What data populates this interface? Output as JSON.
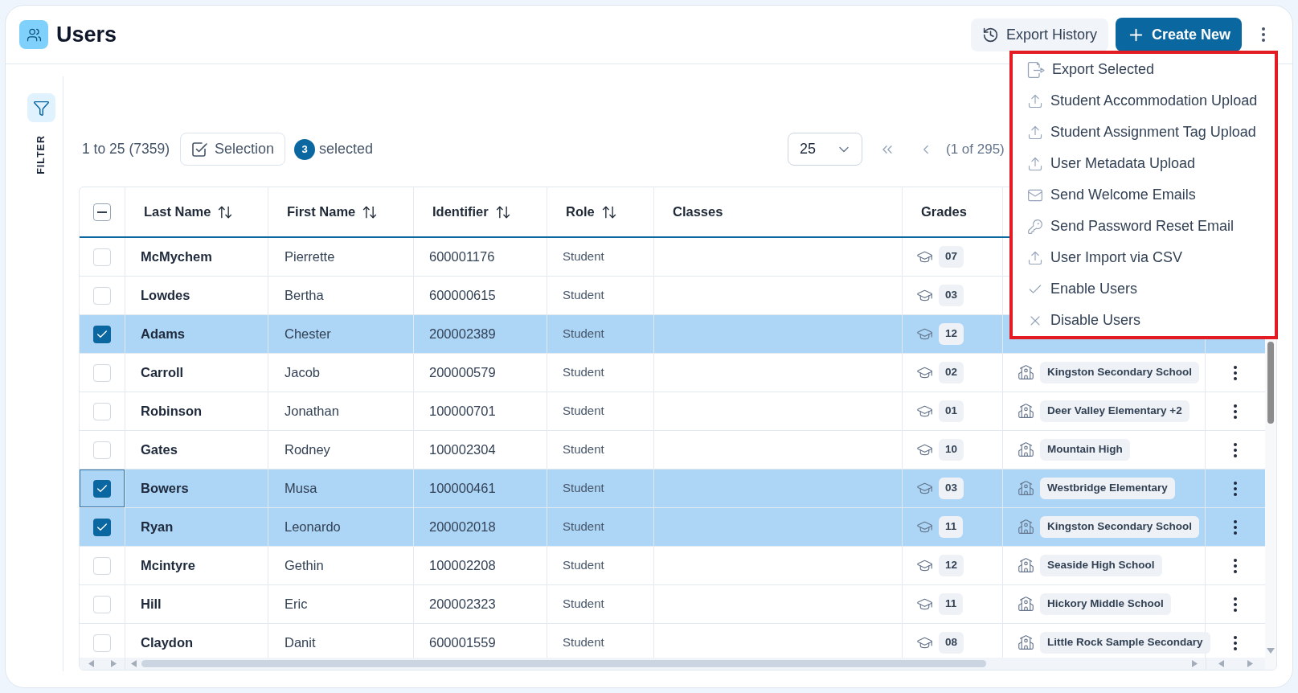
{
  "header": {
    "title": "Users",
    "buttons": [
      {
        "kind": "history",
        "label": "Export History"
      },
      {
        "kind": "create",
        "label": "Create New"
      }
    ]
  },
  "actions_menu": {
    "items": [
      {
        "kind": "export",
        "label": "Export Selected"
      },
      {
        "kind": "upload",
        "label": "Student Accommodation Upload"
      },
      {
        "kind": "upload",
        "label": "Student Assignment Tag Upload"
      },
      {
        "kind": "upload",
        "label": "User Metadata Upload"
      },
      {
        "kind": "email",
        "label": "Send Welcome Emails"
      },
      {
        "kind": "password",
        "label": "Send Password Reset Email"
      },
      {
        "kind": "upload",
        "label": "User Import via CSV"
      },
      {
        "kind": "enable",
        "label": "Enable Users"
      },
      {
        "kind": "disable",
        "label": "Disable Users"
      }
    ]
  },
  "sidebar": {
    "filter_label": "FILTER"
  },
  "toolbar": {
    "range": "1 to 25 (7359)",
    "selection_button": "Selection",
    "selected_count": "3",
    "selected_label": "selected",
    "page_size": "25",
    "page_info": "(1 of 295)"
  },
  "table": {
    "select_all": {
      "indeterminate": true
    },
    "columns": [
      {
        "label": "Last Name",
        "sortable": true
      },
      {
        "label": "First Name",
        "sortable": true
      },
      {
        "label": "Identifier",
        "sortable": true
      },
      {
        "label": "Role",
        "sortable": true
      },
      {
        "label": "Classes",
        "sortable": false
      },
      {
        "label": "Grades",
        "sortable": false
      }
    ],
    "rows": [
      {
        "last_name": "McMychem",
        "first_name": "Pierrette",
        "identifier": "600001176",
        "role": "Student",
        "grade": "07",
        "checked": false,
        "focused": false
      },
      {
        "last_name": "Lowdes",
        "first_name": "Bertha",
        "identifier": "600000615",
        "role": "Student",
        "grade": "03",
        "checked": false,
        "focused": false
      },
      {
        "last_name": "Adams",
        "first_name": "Chester",
        "identifier": "200002389",
        "role": "Student",
        "grade": "12",
        "checked": true,
        "focused": false
      },
      {
        "last_name": "Carroll",
        "first_name": "Jacob",
        "identifier": "200000579",
        "role": "Student",
        "grade": "02",
        "school": "Kingston Secondary School",
        "checked": false,
        "focused": false
      },
      {
        "last_name": "Robinson",
        "first_name": "Jonathan",
        "identifier": "100000701",
        "role": "Student",
        "grade": "01",
        "school": "Deer Valley Elementary +2",
        "checked": false,
        "focused": false
      },
      {
        "last_name": "Gates",
        "first_name": "Rodney",
        "identifier": "100002304",
        "role": "Student",
        "grade": "10",
        "school": "Mountain High",
        "checked": false,
        "focused": false
      },
      {
        "last_name": "Bowers",
        "first_name": "Musa",
        "identifier": "100000461",
        "role": "Student",
        "grade": "03",
        "school": "Westbridge Elementary",
        "checked": true,
        "focused": true
      },
      {
        "last_name": "Ryan",
        "first_name": "Leonardo",
        "identifier": "200002018",
        "role": "Student",
        "grade": "11",
        "school": "Kingston Secondary School",
        "checked": true,
        "focused": false
      },
      {
        "last_name": "Mcintyre",
        "first_name": "Gethin",
        "identifier": "100002208",
        "role": "Student",
        "grade": "12",
        "school": "Seaside High School",
        "checked": false,
        "focused": false
      },
      {
        "last_name": "Hill",
        "first_name": "Eric",
        "identifier": "200002323",
        "role": "Student",
        "grade": "11",
        "school": "Hickory Middle School",
        "checked": false,
        "focused": false
      },
      {
        "last_name": "Claydon",
        "first_name": "Danit",
        "identifier": "600001559",
        "role": "Student",
        "grade": "08",
        "school": "Little Rock Sample Secondary",
        "checked": false,
        "focused": false
      }
    ]
  }
}
